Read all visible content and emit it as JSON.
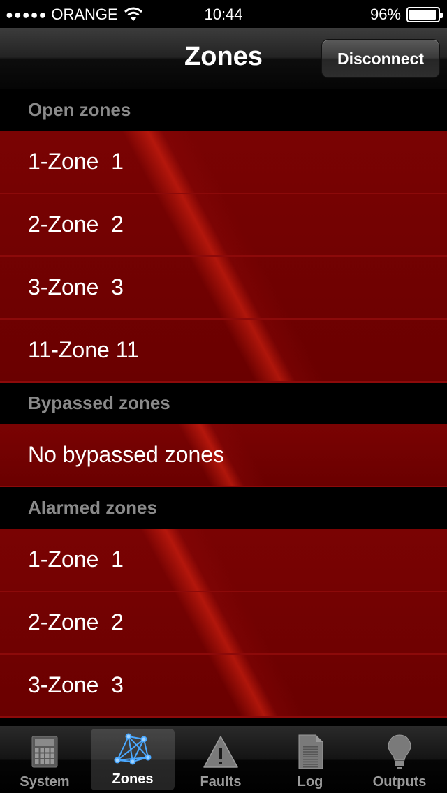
{
  "status_bar": {
    "carrier": "ORANGE",
    "signal_dots": "●●●●●",
    "time": "10:44",
    "battery_percent": "96%",
    "battery_level": 0.96
  },
  "nav": {
    "title": "Zones",
    "disconnect_label": "Disconnect"
  },
  "sections": [
    {
      "header": "Open zones",
      "rows": [
        "1-Zone  1",
        "2-Zone  2",
        "3-Zone  3",
        "11-Zone 11"
      ]
    },
    {
      "header": "Bypassed zones",
      "rows": [
        "No bypassed zones"
      ]
    },
    {
      "header": "Alarmed zones",
      "rows": [
        "1-Zone  1",
        "2-Zone  2",
        "3-Zone  3"
      ]
    }
  ],
  "tabs": [
    {
      "label": "System",
      "icon": "calculator-icon",
      "active": false
    },
    {
      "label": "Zones",
      "icon": "network-icon",
      "active": true
    },
    {
      "label": "Faults",
      "icon": "warning-icon",
      "active": false
    },
    {
      "label": "Log",
      "icon": "document-icon",
      "active": false
    },
    {
      "label": "Outputs",
      "icon": "lightbulb-icon",
      "active": false
    }
  ],
  "colors": {
    "row_background": "#6a0000",
    "row_separator": "#8c0a0a",
    "section_header_text": "#8a8a8a",
    "active_tab_icon": "#4aa8ff"
  }
}
